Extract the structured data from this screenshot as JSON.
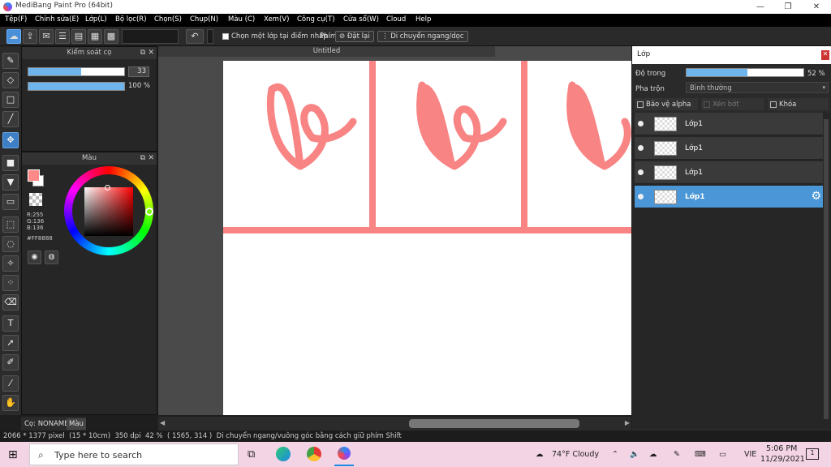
{
  "window": {
    "title": "MediBang Paint Pro (64bit)",
    "minimize": "—",
    "maximize": "❐",
    "close": "✕"
  },
  "menu": [
    "Tệp(F)",
    "Chỉnh sửa(E)",
    "Lớp(L)",
    "Bộ lọc(R)",
    "Chọn(S)",
    "Chụp(N)",
    "Màu (C)",
    "Xem(V)",
    "Công cụ(T)",
    "Cửa sổ(W)",
    "Cloud",
    "Help"
  ],
  "toolbar": {
    "select_layer_label": "Chọn một lớp tại điểm nhấp",
    "key_label": "Phím",
    "reset_label": "Đặt lại",
    "move_label": "Di chuyển ngang/dọc"
  },
  "brush_panel": {
    "title": "Kiểm soát cọ",
    "size_value": "33",
    "size_fraction": 0.55,
    "opacity_value": "100 %",
    "opacity_fraction": 1.0
  },
  "color_panel": {
    "title": "Màu",
    "r": "R:255",
    "g": "G:136",
    "b": "B:136",
    "hex": "#FF8888",
    "fg_color": "#FF8888"
  },
  "left_tabs": {
    "brush_tab": "Cọ: NONAME",
    "color_tab": "Màu"
  },
  "document": {
    "tab_title": "Untitled",
    "stroke_color": "#F88484"
  },
  "layers_panel": {
    "title": "Lớp",
    "opacity_label": "Độ trong",
    "opacity_value": "52 %",
    "opacity_fraction": 0.52,
    "blend_label": "Pha trộn",
    "blend_value": "Bình thường",
    "protect_alpha": "Bảo vệ alpha",
    "clipping": "Xén bớt",
    "lock": "Khóa",
    "layers": [
      {
        "name": "Lớp1",
        "selected": false
      },
      {
        "name": "Lớp1",
        "selected": false
      },
      {
        "name": "Lớp1",
        "selected": false
      },
      {
        "name": "Lớp1",
        "selected": true
      }
    ]
  },
  "status": {
    "size": "2066 * 1377 pixel",
    "cm": "(15 * 10cm)",
    "dpi": "350 dpi",
    "zoom": "42 %",
    "coords": "( 1565, 314 )",
    "hint": "Di chuyển ngang/vuông góc bằng cách giữ phím Shift"
  },
  "taskbar": {
    "search_placeholder": "Type here to search",
    "weather": "74°F  Cloudy",
    "lang": "VIE",
    "time": "5:06 PM",
    "date": "11/29/2021",
    "notif_count": "1"
  }
}
